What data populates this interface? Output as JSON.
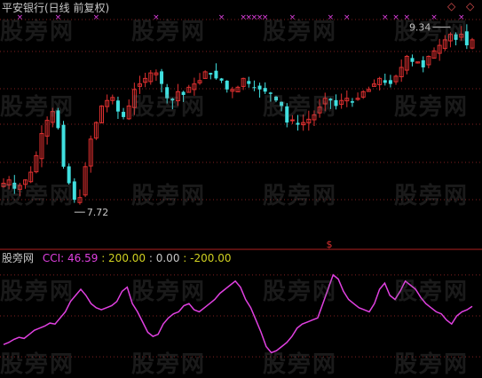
{
  "title": "平安银行(日线 前复权)",
  "watermark": "股旁网",
  "corner_icons": [
    "◇",
    "◇"
  ],
  "indicator": {
    "name": "股旁网",
    "cci_label": "CCI: 46.59",
    "level_high": ": 200.00",
    "level_mid": ": 0.00",
    "level_low": ": -200.00"
  },
  "colors": {
    "background": "#000000",
    "up_candle": "#e03030",
    "down_candle": "#40e0e0",
    "cci_line": "#e040e0",
    "signal_marker": "#e040e0",
    "grid": "#802020"
  },
  "chart_data": [
    {
      "type": "candlestick",
      "title": "平安银行(日线 前复权)",
      "annotations": [
        {
          "text": "7.72",
          "kind": "low"
        },
        {
          "text": "9.34",
          "kind": "high"
        }
      ],
      "signal_marker": "×",
      "bottom_marker": "$",
      "close_path": [
        7.95,
        7.98,
        7.9,
        7.93,
        7.98,
        8.05,
        8.2,
        8.4,
        8.52,
        8.6,
        8.45,
        8.1,
        7.95,
        7.8,
        7.82,
        8.1,
        8.35,
        8.5,
        8.65,
        8.7,
        8.7,
        8.6,
        8.55,
        8.65,
        8.8,
        8.85,
        8.9,
        8.95,
        8.95,
        8.85,
        8.72,
        8.7,
        8.78,
        8.75,
        8.82,
        8.85,
        8.88,
        8.96,
        8.95,
        8.9,
        8.88,
        8.8,
        8.8,
        8.82,
        8.9,
        8.85,
        8.82,
        8.8,
        8.78,
        8.76,
        8.7,
        8.65,
        8.5,
        8.52,
        8.48,
        8.5,
        8.53,
        8.57,
        8.64,
        8.72,
        8.7,
        8.65,
        8.7,
        8.72,
        8.68,
        8.72,
        8.78,
        8.8,
        8.85,
        8.9,
        8.86,
        8.85,
        8.92,
        9.0,
        9.1,
        9.05,
        9.05,
        9.0,
        9.1,
        9.15,
        9.2,
        9.25,
        9.3,
        9.25,
        9.3,
        9.2,
        9.25
      ]
    },
    {
      "type": "line",
      "series": [
        {
          "name": "CCI",
          "values": [
            -140,
            -130,
            -115,
            -105,
            -110,
            -90,
            -70,
            -60,
            -50,
            -35,
            -40,
            -10,
            20,
            70,
            100,
            130,
            100,
            60,
            40,
            30,
            40,
            50,
            70,
            120,
            140,
            60,
            20,
            -30,
            -80,
            -100,
            -90,
            -40,
            -10,
            10,
            20,
            50,
            60,
            30,
            20,
            40,
            60,
            80,
            110,
            130,
            150,
            170,
            140,
            80,
            40,
            -20,
            -80,
            -150,
            -180,
            -170,
            -150,
            -130,
            -100,
            -60,
            -40,
            -30,
            -20,
            -10,
            60,
            130,
            200,
            180,
            120,
            80,
            60,
            40,
            30,
            20,
            60,
            130,
            160,
            100,
            80,
            120,
            170,
            150,
            130,
            90,
            60,
            40,
            20,
            10,
            -20,
            -40,
            0,
            20,
            30,
            46.59
          ]
        }
      ],
      "levels": [
        200,
        0,
        -200
      ],
      "ylim": [
        -260,
        260
      ]
    }
  ]
}
